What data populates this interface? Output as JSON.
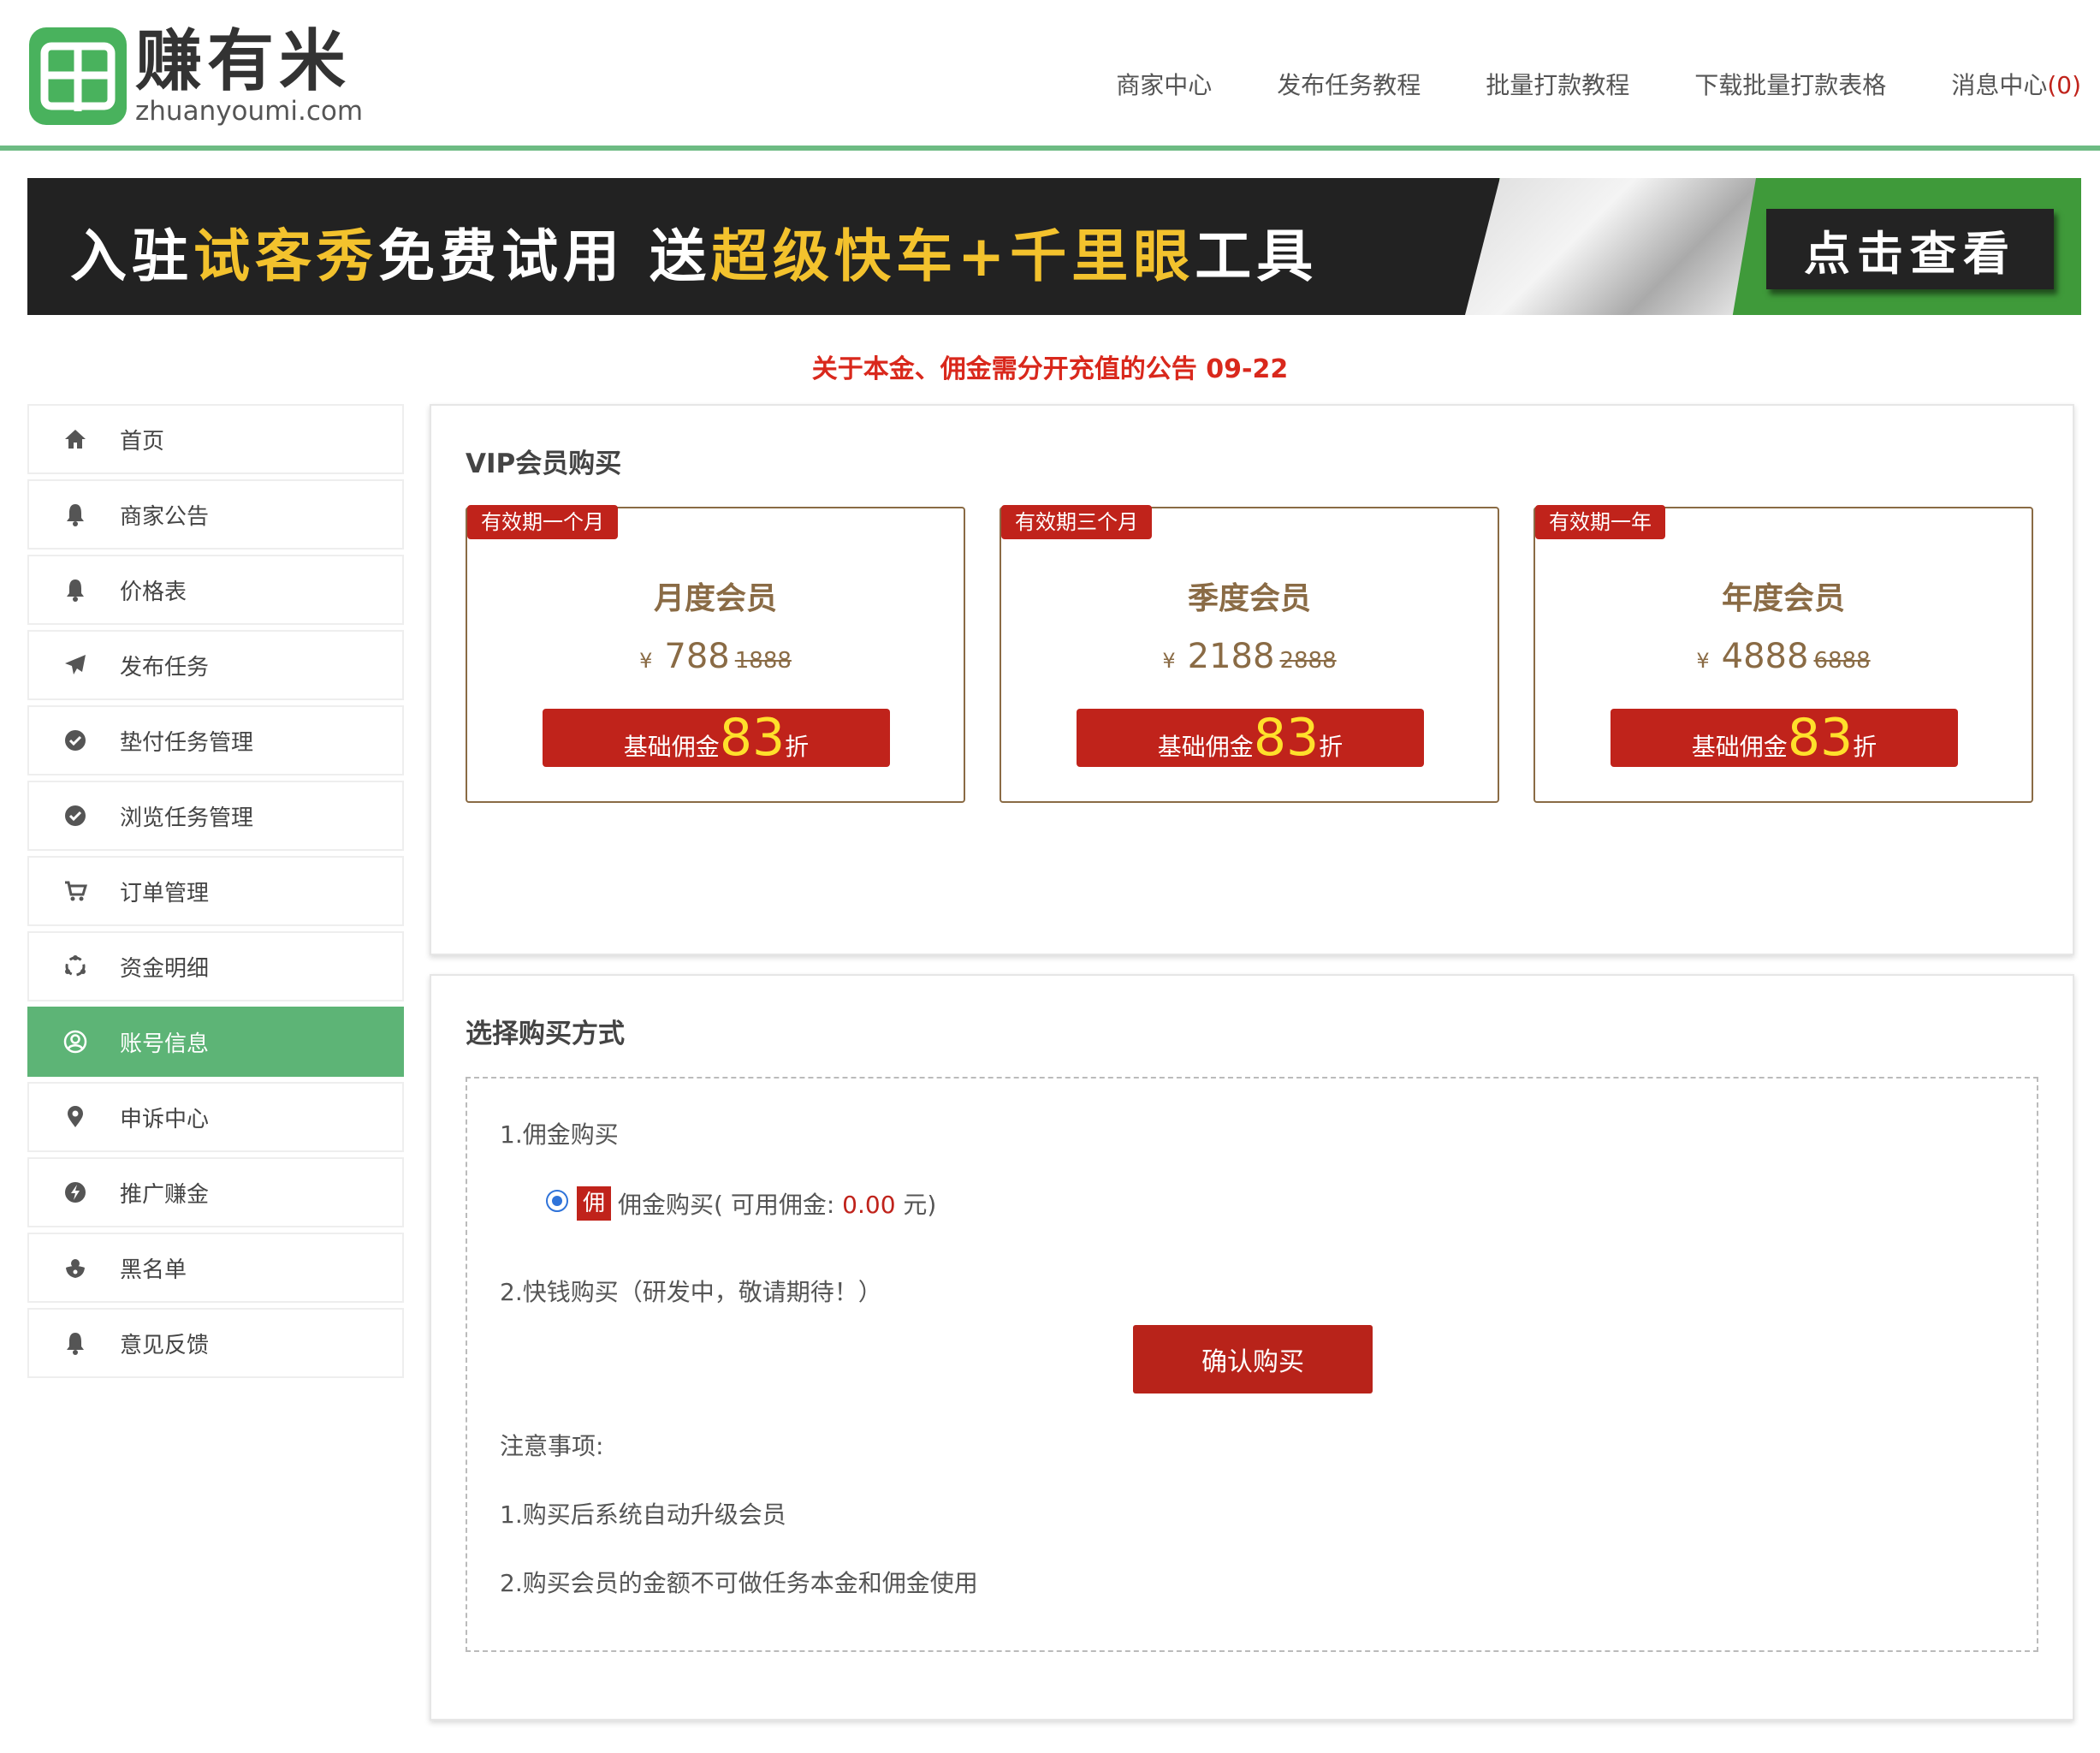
{
  "brand": {
    "cn": "赚有米",
    "en": "zhuanyoumi.com"
  },
  "topnav": [
    {
      "label": "商家中心"
    },
    {
      "label": "发布任务教程"
    },
    {
      "label": "批量打款教程"
    },
    {
      "label": "下载批量打款表格"
    }
  ],
  "message_center": {
    "label": "消息中心",
    "count": "(0)"
  },
  "banner": {
    "t1": "入驻",
    "t2": "试客秀",
    "t3": "免费试用 送",
    "t4": "超级快车+千里眼",
    "t5": "工具",
    "button": "点击查看"
  },
  "notice": "关于本金、佣金需分开充值的公告 09-22",
  "sidebar": {
    "items": [
      {
        "label": "首页",
        "icon": "home-icon"
      },
      {
        "label": "商家公告",
        "icon": "bell-icon"
      },
      {
        "label": "价格表",
        "icon": "bell-icon"
      },
      {
        "label": "发布任务",
        "icon": "paper-plane-icon"
      },
      {
        "label": "垫付任务管理",
        "icon": "check-circle-icon"
      },
      {
        "label": "浏览任务管理",
        "icon": "check-circle-icon"
      },
      {
        "label": "订单管理",
        "icon": "cart-icon"
      },
      {
        "label": "资金明细",
        "icon": "recycle-icon"
      },
      {
        "label": "账号信息",
        "icon": "user-circle-icon",
        "active": true
      },
      {
        "label": "申诉中心",
        "icon": "map-pin-icon"
      },
      {
        "label": "推广赚金",
        "icon": "bolt-icon"
      },
      {
        "label": "黑名单",
        "icon": "user-shield-icon"
      },
      {
        "label": "意见反馈",
        "icon": "bell-icon"
      }
    ]
  },
  "vip": {
    "title": "VIP会员购买",
    "cards": [
      {
        "tag": "有效期一个月",
        "name": "月度会员",
        "currency": "¥",
        "price": "788",
        "old_price": "1888",
        "disc_prefix": "基础佣金",
        "disc_value": "83",
        "disc_suffix": "折"
      },
      {
        "tag": "有效期三个月",
        "name": "季度会员",
        "currency": "¥",
        "price": "2188",
        "old_price": "2888",
        "disc_prefix": "基础佣金",
        "disc_value": "83",
        "disc_suffix": "折"
      },
      {
        "tag": "有效期一年",
        "name": "年度会员",
        "currency": "¥",
        "price": "4888",
        "old_price": "6888",
        "disc_prefix": "基础佣金",
        "disc_value": "83",
        "disc_suffix": "折"
      }
    ]
  },
  "payment": {
    "title": "选择购买方式",
    "method1_title": "1.佣金购买",
    "badge": "佣",
    "option_prefix": "佣金购买( 可用佣金: ",
    "available": "0.00",
    "option_suffix": " 元)",
    "method2_title": "2.快钱购买（研发中，敬请期待！）",
    "confirm_label": "确认购买",
    "notes_title": "注意事项:",
    "notes": [
      "1.购买后系统自动升级会员",
      "2.购买会员的金额不可做任务本金和佣金使用"
    ]
  },
  "colors": {
    "accent_green": "#5db476",
    "primary_red": "#c0231b",
    "gold": "#8a6b45"
  }
}
